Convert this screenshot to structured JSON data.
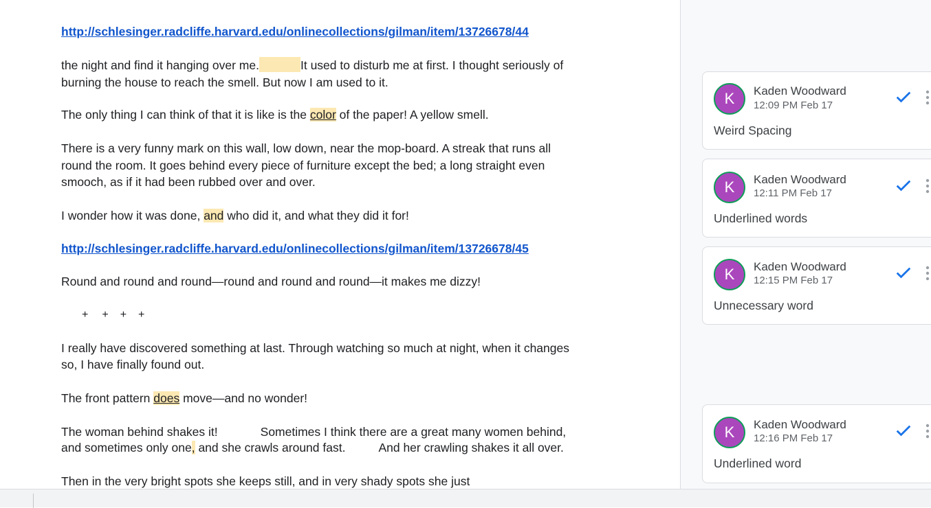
{
  "document": {
    "link1": "http://schlesinger.radcliffe.harvard.edu/onlinecollections/gilman/item/13726678/44",
    "p1_l1_a": "the night and find it hanging over me.",
    "p1_l1_b": "It used to disturb me at first. I thought seriously of",
    "p1_l2": "burning the house to reach the smell. But now I am used to it.",
    "p2_a": "The only thing I can think of that it is like is the ",
    "p2_hl": "color",
    "p2_b": " of the paper! A yellow smell.",
    "p3_l1": "There is a very funny mark on this wall, low down, near the mop-board. A streak that runs all",
    "p3_l2": "round the room. It goes behind every piece of furniture except the bed; a long straight even",
    "p3_l3": "smooch, as if it had been rubbed over and over.",
    "p4_a": "I wonder how it was done, ",
    "p4_hl": "and",
    "p4_b": " who did it, and what they did it for!",
    "link2": "http://schlesinger.radcliffe.harvard.edu/onlinecollections/gilman/item/13726678/45",
    "p5": "Round and round and round—round and round and round—it makes me dizzy!",
    "separator": [
      "+",
      "+",
      "+",
      "+"
    ],
    "p6_l1": "I really have discovered something at last. Through watching so much at night, when it changes",
    "p6_l2": "so, I have finally found out.",
    "p7_a": "The front pattern ",
    "p7_hl": "does",
    "p7_b": " move—and no wonder!",
    "p8_l1_a": "The woman behind shakes it!",
    "p8_l1_b": "Sometimes I think there are a great many women behind,",
    "p8_l2_a": "and sometimes only one",
    "p8_l2_hl": ",",
    "p8_l2_b": " and she crawls around fast.",
    "p8_l2_c": "And her crawling shakes it all over.",
    "p9": "Then in the very bright spots she keeps still, and in very shady spots she just"
  },
  "comments": [
    {
      "initial": "K",
      "author": "Kaden Woodward",
      "time": "12:09 PM Feb 17",
      "text": "Weird Spacing"
    },
    {
      "initial": "K",
      "author": "Kaden Woodward",
      "time": "12:11 PM Feb 17",
      "text": "Underlined words"
    },
    {
      "initial": "K",
      "author": "Kaden Woodward",
      "time": "12:15 PM Feb 17",
      "text": "Unnecessary word"
    },
    {
      "initial": "K",
      "author": "Kaden Woodward",
      "time": "12:16 PM Feb 17",
      "text": "Underlined word"
    }
  ],
  "colors": {
    "highlight": "#fce8b2",
    "link": "#1155cc",
    "avatar": "#ab47bc",
    "avatar_ring": "#0f9d58",
    "check": "#1a73e8"
  },
  "icons": {
    "resolve": "check-icon",
    "more": "more-vert-icon"
  }
}
